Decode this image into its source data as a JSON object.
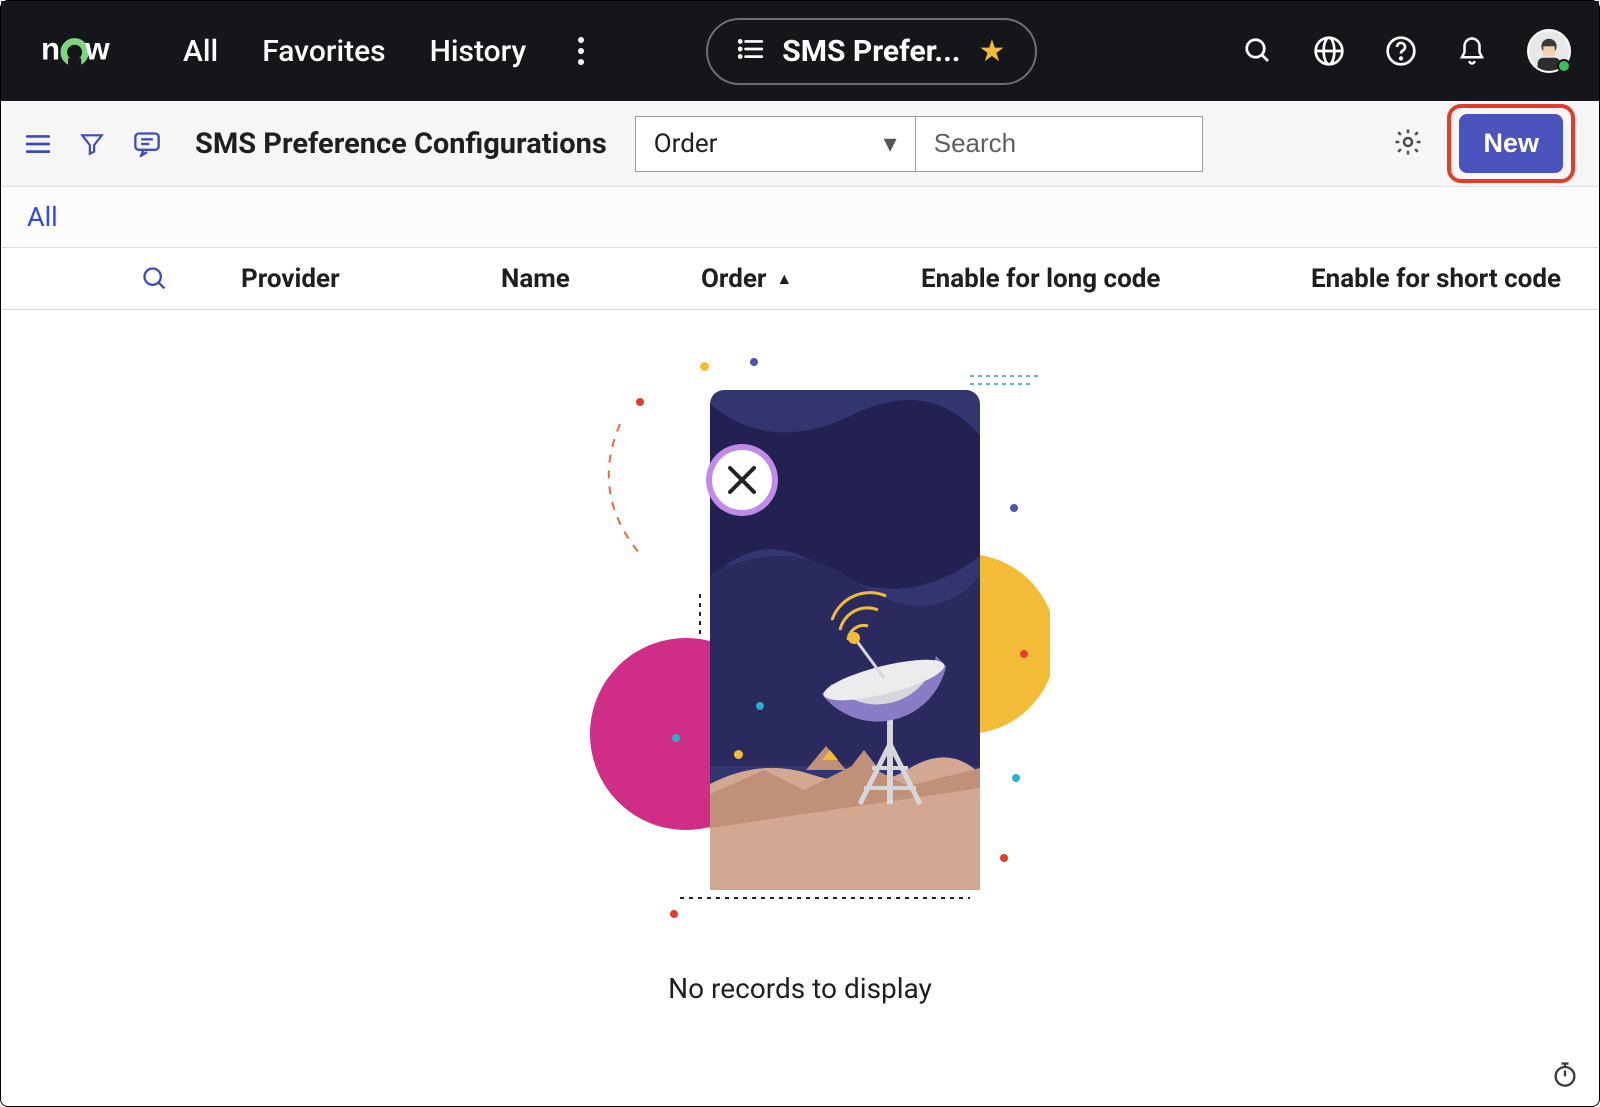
{
  "banner": {
    "logo_text": "now",
    "nav": {
      "all": "All",
      "favorites": "Favorites",
      "history": "History"
    },
    "context_label": "SMS Prefer..."
  },
  "toolbar": {
    "page_title": "SMS Preference Configurations",
    "filter_by_selected": "Order",
    "search_placeholder": "Search",
    "new_label": "New"
  },
  "breadcrumb": {
    "all": "All"
  },
  "columns": {
    "provider": "Provider",
    "name": "Name",
    "order": "Order",
    "enable_long": "Enable for long code",
    "enable_short": "Enable for short code"
  },
  "empty": {
    "message": "No records to display"
  },
  "icons": {
    "menu": "menu-icon",
    "filter": "filter-icon",
    "activity": "activity-icon",
    "gear": "gear-icon",
    "search": "search-icon",
    "globe": "globe-icon",
    "help": "help-icon",
    "bell": "bell-icon",
    "list": "list-icon",
    "star": "star-icon",
    "timing": "timing-icon"
  }
}
